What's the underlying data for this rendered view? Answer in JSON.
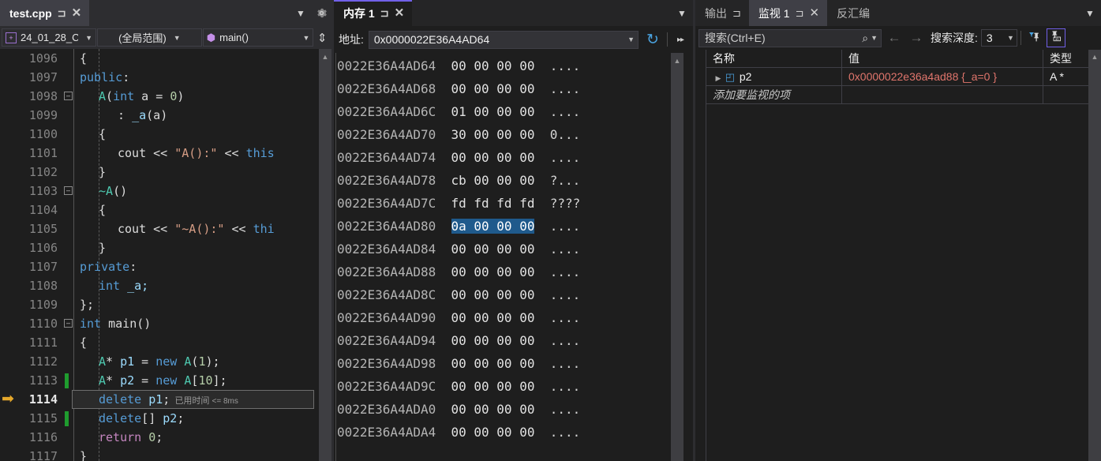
{
  "editor": {
    "tab": {
      "label": "test.cpp",
      "pin_icon": "pin-icon",
      "close_icon": "close-icon"
    },
    "chevron_icon": "chevron-down-icon",
    "gear_icon": "gear-icon",
    "navbar": {
      "project": "24_01_28_C",
      "project_icon": "cpp-project-icon",
      "scope": "(全局范围)",
      "function": "main()",
      "function_icon": "method-cube-icon",
      "split_icon": "split-view-icon"
    },
    "elapsed_label": "已用时间",
    "elapsed_value": "<= 8ms",
    "current_line": 1114,
    "lines": [
      {
        "no": "1096",
        "bp": false,
        "indent": 0,
        "fold": false,
        "tokens": [
          {
            "t": "{",
            "c": "pln"
          }
        ]
      },
      {
        "no": "1097",
        "bp": false,
        "indent": 0,
        "fold": false,
        "tokens": [
          {
            "t": "public",
            "c": "k"
          },
          {
            "t": ":",
            "c": "pln"
          }
        ]
      },
      {
        "no": "1098",
        "bp": false,
        "indent": 1,
        "fold": true,
        "tokens": [
          {
            "t": "A",
            "c": "typ"
          },
          {
            "t": "(",
            "c": "pln"
          },
          {
            "t": "int",
            "c": "k"
          },
          {
            "t": " a = ",
            "c": "pln"
          },
          {
            "t": "0",
            "c": "num"
          },
          {
            "t": ")",
            "c": "pln"
          }
        ]
      },
      {
        "no": "1099",
        "bp": false,
        "indent": 2,
        "fold": false,
        "tokens": [
          {
            "t": ": ",
            "c": "pln"
          },
          {
            "t": "_a",
            "c": "var"
          },
          {
            "t": "(",
            "c": "pln"
          },
          {
            "t": "a",
            "c": "pln"
          },
          {
            "t": ")",
            "c": "pln"
          }
        ]
      },
      {
        "no": "1100",
        "bp": false,
        "indent": 1,
        "fold": false,
        "tokens": [
          {
            "t": "{",
            "c": "pln"
          }
        ]
      },
      {
        "no": "1101",
        "bp": false,
        "indent": 2,
        "fold": false,
        "tokens": [
          {
            "t": "cout",
            "c": "pln"
          },
          {
            "t": " << ",
            "c": "pln"
          },
          {
            "t": "\"A():\"",
            "c": "str"
          },
          {
            "t": " << ",
            "c": "pln"
          },
          {
            "t": "this",
            "c": "k"
          }
        ]
      },
      {
        "no": "1102",
        "bp": false,
        "indent": 1,
        "fold": false,
        "tokens": [
          {
            "t": "}",
            "c": "pln"
          }
        ]
      },
      {
        "no": "1103",
        "bp": false,
        "indent": 1,
        "fold": true,
        "tokens": [
          {
            "t": "~A",
            "c": "typ"
          },
          {
            "t": "()",
            "c": "pln"
          }
        ]
      },
      {
        "no": "1104",
        "bp": false,
        "indent": 1,
        "fold": false,
        "tokens": [
          {
            "t": "{",
            "c": "pln"
          }
        ]
      },
      {
        "no": "1105",
        "bp": false,
        "indent": 2,
        "fold": false,
        "tokens": [
          {
            "t": "cout",
            "c": "pln"
          },
          {
            "t": " << ",
            "c": "pln"
          },
          {
            "t": "\"~A():\"",
            "c": "str"
          },
          {
            "t": " << ",
            "c": "pln"
          },
          {
            "t": "thi",
            "c": "k"
          }
        ]
      },
      {
        "no": "1106",
        "bp": false,
        "indent": 1,
        "fold": false,
        "tokens": [
          {
            "t": "}",
            "c": "pln"
          }
        ]
      },
      {
        "no": "1107",
        "bp": false,
        "indent": 0,
        "fold": false,
        "tokens": [
          {
            "t": "private",
            "c": "k"
          },
          {
            "t": ":",
            "c": "pln"
          }
        ]
      },
      {
        "no": "1108",
        "bp": false,
        "indent": 1,
        "fold": false,
        "tokens": [
          {
            "t": "int",
            "c": "k"
          },
          {
            "t": " _a;",
            "c": "var"
          }
        ]
      },
      {
        "no": "1109",
        "bp": false,
        "indent": 0,
        "fold": false,
        "tokens": [
          {
            "t": "};",
            "c": "pln"
          }
        ]
      },
      {
        "no": "1110",
        "bp": false,
        "indent": 0,
        "fold": true,
        "tokens": [
          {
            "t": "int",
            "c": "k"
          },
          {
            "t": " ",
            "c": "pln"
          },
          {
            "t": "main",
            "c": "pln"
          },
          {
            "t": "()",
            "c": "pln"
          }
        ]
      },
      {
        "no": "1111",
        "bp": false,
        "indent": 0,
        "fold": false,
        "tokens": [
          {
            "t": "{",
            "c": "pln"
          }
        ]
      },
      {
        "no": "1112",
        "bp": false,
        "indent": 1,
        "fold": false,
        "tokens": [
          {
            "t": "A",
            "c": "typ"
          },
          {
            "t": "* ",
            "c": "pln"
          },
          {
            "t": "p1",
            "c": "var"
          },
          {
            "t": " = ",
            "c": "pln"
          },
          {
            "t": "new",
            "c": "k"
          },
          {
            "t": " ",
            "c": "pln"
          },
          {
            "t": "A",
            "c": "typ"
          },
          {
            "t": "(",
            "c": "pln"
          },
          {
            "t": "1",
            "c": "num"
          },
          {
            "t": ");",
            "c": "pln"
          }
        ]
      },
      {
        "no": "1113",
        "bp": true,
        "indent": 1,
        "fold": false,
        "tokens": [
          {
            "t": "A",
            "c": "typ"
          },
          {
            "t": "* ",
            "c": "pln"
          },
          {
            "t": "p2",
            "c": "var"
          },
          {
            "t": " = ",
            "c": "pln"
          },
          {
            "t": "new",
            "c": "k"
          },
          {
            "t": " ",
            "c": "pln"
          },
          {
            "t": "A",
            "c": "typ"
          },
          {
            "t": "[",
            "c": "pln"
          },
          {
            "t": "10",
            "c": "num"
          },
          {
            "t": "];",
            "c": "pln"
          }
        ]
      },
      {
        "no": "1114",
        "bp": false,
        "indent": 1,
        "fold": false,
        "current": true,
        "tokens": [
          {
            "t": "delete",
            "c": "k"
          },
          {
            "t": " ",
            "c": "pln"
          },
          {
            "t": "p1",
            "c": "var"
          },
          {
            "t": ";",
            "c": "pln"
          }
        ]
      },
      {
        "no": "1115",
        "bp": true,
        "indent": 1,
        "fold": false,
        "tokens": [
          {
            "t": "delete",
            "c": "k"
          },
          {
            "t": "[] ",
            "c": "pln"
          },
          {
            "t": "p2",
            "c": "var"
          },
          {
            "t": ";",
            "c": "pln"
          }
        ]
      },
      {
        "no": "1116",
        "bp": false,
        "indent": 1,
        "fold": false,
        "tokens": [
          {
            "t": "return",
            "c": "kp"
          },
          {
            "t": " ",
            "c": "pln"
          },
          {
            "t": "0",
            "c": "num"
          },
          {
            "t": ";",
            "c": "pln"
          }
        ]
      },
      {
        "no": "1117",
        "bp": false,
        "indent": 0,
        "fold": false,
        "tokens": [
          {
            "t": "}",
            "c": "pln"
          }
        ]
      }
    ]
  },
  "memory": {
    "tab": {
      "label": "内存 1",
      "pin_icon": "pin-icon",
      "close_icon": "close-icon"
    },
    "chevron_icon": "chevron-down-icon",
    "address_label": "地址:",
    "address_value": "0x0000022E36A4AD64",
    "refresh_icon": "refresh-icon",
    "overflow_icon": "overflow-chevrons-icon",
    "selected_address": "0022E36A4AD80",
    "rows": [
      {
        "addr": "0022E36A4AD64",
        "hex": "00 00 00 00",
        "ascii": "....",
        "sel": false
      },
      {
        "addr": "0022E36A4AD68",
        "hex": "00 00 00 00",
        "ascii": "....",
        "sel": false
      },
      {
        "addr": "0022E36A4AD6C",
        "hex": "01 00 00 00",
        "ascii": "....",
        "sel": false
      },
      {
        "addr": "0022E36A4AD70",
        "hex": "30 00 00 00",
        "ascii": "0...",
        "sel": false
      },
      {
        "addr": "0022E36A4AD74",
        "hex": "00 00 00 00",
        "ascii": "....",
        "sel": false
      },
      {
        "addr": "0022E36A4AD78",
        "hex": "cb 00 00 00",
        "ascii": "?...",
        "sel": false
      },
      {
        "addr": "0022E36A4AD7C",
        "hex": "fd fd fd fd",
        "ascii": "????",
        "sel": false
      },
      {
        "addr": "0022E36A4AD80",
        "hex": "0a 00 00 00",
        "ascii": "....",
        "sel": true
      },
      {
        "addr": "0022E36A4AD84",
        "hex": "00 00 00 00",
        "ascii": "....",
        "sel": false
      },
      {
        "addr": "0022E36A4AD88",
        "hex": "00 00 00 00",
        "ascii": "....",
        "sel": false
      },
      {
        "addr": "0022E36A4AD8C",
        "hex": "00 00 00 00",
        "ascii": "....",
        "sel": false
      },
      {
        "addr": "0022E36A4AD90",
        "hex": "00 00 00 00",
        "ascii": "....",
        "sel": false
      },
      {
        "addr": "0022E36A4AD94",
        "hex": "00 00 00 00",
        "ascii": "....",
        "sel": false
      },
      {
        "addr": "0022E36A4AD98",
        "hex": "00 00 00 00",
        "ascii": "....",
        "sel": false
      },
      {
        "addr": "0022E36A4AD9C",
        "hex": "00 00 00 00",
        "ascii": "....",
        "sel": false
      },
      {
        "addr": "0022E36A4ADA0",
        "hex": "00 00 00 00",
        "ascii": "....",
        "sel": false
      },
      {
        "addr": "0022E36A4ADA4",
        "hex": "00 00 00 00",
        "ascii": "....",
        "sel": false
      }
    ]
  },
  "watch": {
    "tabs": [
      {
        "label": "输出",
        "active": false,
        "pin": true,
        "close": false
      },
      {
        "label": "监视 1",
        "active": true,
        "pin": true,
        "close": true
      },
      {
        "label": "反汇编",
        "active": false,
        "pin": false,
        "close": false
      }
    ],
    "chevron_icon": "chevron-down-icon",
    "search_placeholder": "搜索(Ctrl+E)",
    "search_icon": "search-icon",
    "search_dropdown_icon": "chevron-down-icon",
    "prev_icon": "arrow-left-icon",
    "next_icon": "arrow-right-icon",
    "depth_label": "搜索深度:",
    "depth_value": "3",
    "pin_filter_icon": "filtered-pin-icon",
    "hex_toggle_icon": "pin-ab-icon",
    "columns": [
      "名称",
      "值",
      "类型"
    ],
    "rows": [
      {
        "name": "p2",
        "value": "0x0000022e36a4ad88 {_a=0 }",
        "type": "A *",
        "expander_icon": "chevron-right-icon",
        "object_icon": "cube-icon"
      }
    ],
    "add_item_placeholder": "添加要监视的项"
  },
  "colors": {
    "accent": "#7160e8",
    "selection": "#1f5a8c",
    "breakpoint": "#1f9c2e",
    "current_arrow": "#e5a82b",
    "value_text": "#e0756c"
  }
}
